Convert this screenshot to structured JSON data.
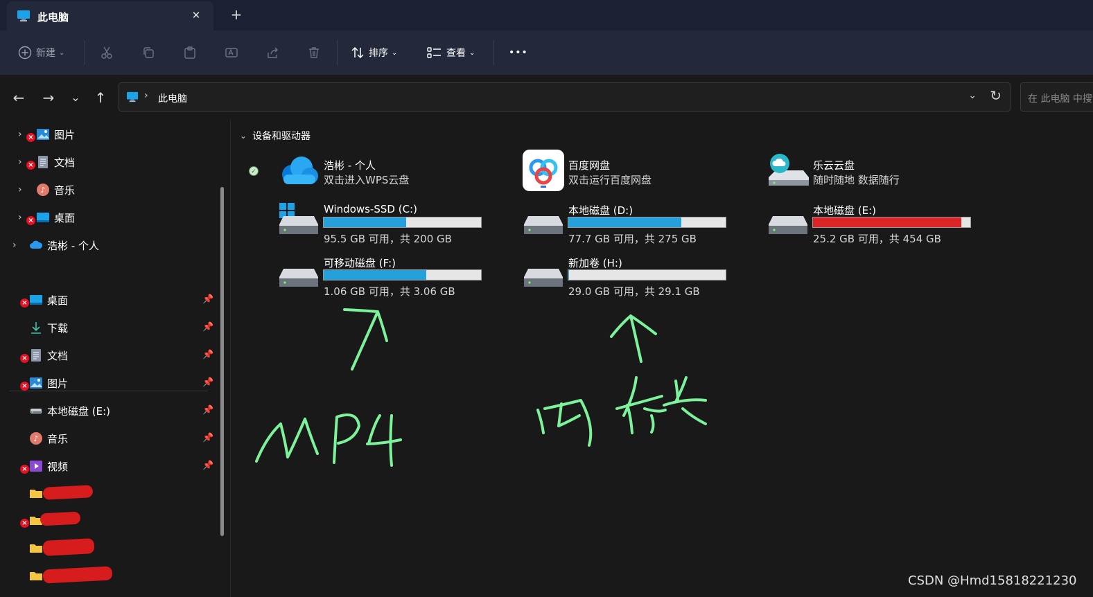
{
  "window": {
    "tab_title": "此电脑",
    "tab_close": "✕",
    "new_tab": "+"
  },
  "toolbar": {
    "new_label": "新建",
    "sort_label": "排序",
    "view_label": "查看",
    "more_label": "•••"
  },
  "address": {
    "path": "此电脑",
    "separator": "›",
    "search_placeholder": "在 此电脑 中搜索"
  },
  "sidebar": {
    "tree": [
      {
        "label": "图片",
        "icon": "pictures-icon",
        "error": true
      },
      {
        "label": "文档",
        "icon": "documents-icon",
        "error": true
      },
      {
        "label": "音乐",
        "icon": "music-icon",
        "error": false
      },
      {
        "label": "桌面",
        "icon": "desktop-icon",
        "error": true
      },
      {
        "label": "浩彬 - 个人",
        "icon": "cloud-icon",
        "error": false
      }
    ],
    "quick_access": [
      {
        "label": "桌面",
        "icon": "desktop-icon",
        "error": true
      },
      {
        "label": "下载",
        "icon": "download-icon",
        "error": false
      },
      {
        "label": "文档",
        "icon": "documents-icon",
        "error": true
      },
      {
        "label": "图片",
        "icon": "pictures-icon",
        "error": true
      },
      {
        "label": "本地磁盘 (E:)",
        "icon": "drive-icon",
        "error": false
      },
      {
        "label": "音乐",
        "icon": "music-icon",
        "error": false
      },
      {
        "label": "视频",
        "icon": "videos-icon",
        "error": true
      }
    ]
  },
  "content": {
    "section_title": "设备和驱动器",
    "apps": [
      {
        "name": "浩彬 - 个人",
        "sub": "双击进入WPS云盘",
        "icon": "wps-cloud-icon"
      },
      {
        "name": "百度网盘",
        "sub": "双击运行百度网盘",
        "icon": "baidu-netdisk-icon"
      },
      {
        "name": "乐云云盘",
        "sub": "随时随地 数据随行",
        "icon": "leyun-cloud-icon"
      }
    ],
    "drives": [
      {
        "name": "Windows-SSD (C:)",
        "info": "95.5 GB 可用，共 200 GB",
        "used_pct": 52.25,
        "color": "#26a0da"
      },
      {
        "name": "本地磁盘 (D:)",
        "info": "77.7 GB 可用，共 275 GB",
        "used_pct": 71.75,
        "color": "#26a0da"
      },
      {
        "name": "本地磁盘 (E:)",
        "info": "25.2 GB 可用，共 454 GB",
        "used_pct": 94.45,
        "color": "#da2626"
      },
      {
        "name": "可移动磁盘 (F:)",
        "info": "1.06 GB 可用，共 3.06 GB",
        "used_pct": 65.36,
        "color": "#26a0da"
      },
      {
        "name": "新加卷 (H:)",
        "info": "29.0 GB 可用，共 29.1 GB",
        "used_pct": 0.34,
        "color": "#26a0da"
      }
    ]
  },
  "annotations": {
    "mp4_text": "MP4",
    "card_text": "内存卡",
    "ink_color": "#7cf29a"
  },
  "watermark": "CSDN @Hmd15818221230"
}
